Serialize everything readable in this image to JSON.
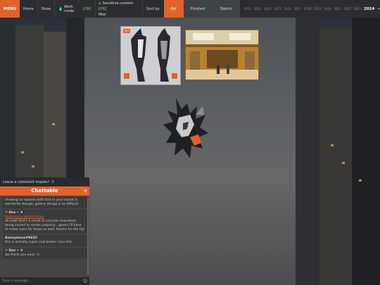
{
  "topbar": {
    "menu": "MENU",
    "home": "Home",
    "show": "Show",
    "work_mode_label": "Work mode",
    "work_mode_state": "[ON]",
    "sensitive_label": "Sensitive content",
    "sensitive_state": "[ON]",
    "filter_label": "filter",
    "sort_by": "Sort by:",
    "ref": "Ref",
    "finished": "Finished",
    "sketch": "Sketch",
    "years": [
      "2012",
      "2013",
      "2014",
      "2015",
      "2016",
      "2017",
      "2018",
      "2019",
      "2020",
      "2021",
      "2022",
      "2023"
    ],
    "current_year": "2024",
    "arrow": "»",
    "accent": "#e2622a"
  },
  "gallery": {
    "badge": "Ref"
  },
  "chat": {
    "prompt": "Leave a comment maybe? :3",
    "title": "Chattable",
    "messages": [
      {
        "text": "showing as squares with text in your layout is wonderful though, gallery design is so difficult"
      },
      {
        "who": "Dox",
        "reply": "Replying to @dontvalian",
        "text": "oh yeah that's a result of unicode characters being cursed to render properly... guess i'll have to make icons for those as well, thanks for the tip!"
      },
      {
        "who": "Anonymous#6632",
        "text": "this is actually super cool broski i love this"
      },
      {
        "who": "Dox",
        "text": "aw thank you anon :3"
      }
    ],
    "input_placeholder": "Type a message..."
  }
}
